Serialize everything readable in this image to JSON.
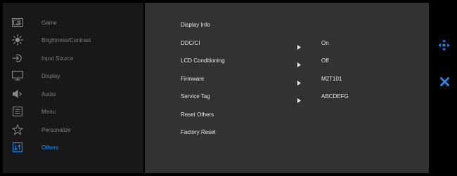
{
  "sidebar": {
    "items": [
      {
        "label": "Game",
        "icon": "game-icon"
      },
      {
        "label": "Brightness/Contrast",
        "icon": "brightness-icon"
      },
      {
        "label": "Input Source",
        "icon": "input-source-icon"
      },
      {
        "label": "Display",
        "icon": "display-icon"
      },
      {
        "label": "Audio",
        "icon": "audio-icon"
      },
      {
        "label": "Menu",
        "icon": "menu-icon"
      },
      {
        "label": "Personalize",
        "icon": "star-icon"
      },
      {
        "label": "Others",
        "icon": "others-icon",
        "active": true
      }
    ]
  },
  "others": {
    "rows": [
      {
        "label": "Display Info",
        "value": ""
      },
      {
        "label": "DDC/CI",
        "value": "On"
      },
      {
        "label": "LCD Conditioning",
        "value": "Off"
      },
      {
        "label": "Firmware",
        "value": "M2T101"
      },
      {
        "label": "Service Tag",
        "value": "ABCDEFG"
      },
      {
        "label": "Reset Others",
        "value": ""
      },
      {
        "label": "Factory Reset",
        "value": ""
      }
    ]
  },
  "colors": {
    "accent": "#1e90ff",
    "inactive_text": "#7e7e7e",
    "panel_bg": "#323232",
    "sidebar_bg": "#181818"
  },
  "controls": {
    "navigate_icon": "four-way-arrows-icon",
    "exit_icon": "close-icon"
  }
}
